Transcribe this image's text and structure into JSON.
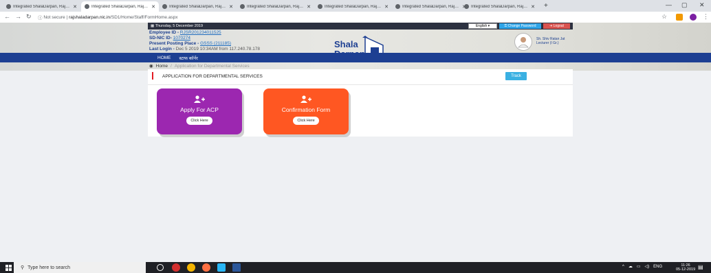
{
  "browser": {
    "tabs": [
      {
        "title": "Integrated ShalaDarpan, Rajasth",
        "active": false
      },
      {
        "title": "Integrated ShalaDarpan, Rajasth",
        "active": true
      },
      {
        "title": "Integrated ShalaDarpan, Rajasth",
        "active": false
      },
      {
        "title": "Integrated ShalaDarpan, Rajasth",
        "active": false
      },
      {
        "title": "Integrated ShalaDarpan, Rajasth",
        "active": false
      },
      {
        "title": "Integrated ShalaDarpan, Rajasth",
        "active": false
      },
      {
        "title": "Integrated ShalaDarpan, Rajasth",
        "active": false
      }
    ],
    "security_label": "Not secure",
    "url_host": "rajshaladarpan.nic.in",
    "url_path": "/SD1/Home/Staff/FormHome.aspx"
  },
  "header": {
    "date": "Thursday, 5 December 2019",
    "language": "English",
    "change_password": "Change Password",
    "logout": "Logout",
    "employee_id_label": "Employee ID -",
    "employee_id": "RJSR201234011525",
    "sdnic_label": "SD-NIC ID-",
    "sdnic_id": "1070274",
    "posting_label": "Present Posting Place -",
    "posting_place": "GSSS (211185)",
    "last_login_label": "Last Login -",
    "last_login": "Dec 5 2019 10:34AM from 117.240.78.178",
    "logo_line1": "Shala",
    "logo_line2": "Darpan",
    "profile_name": "Sh. Shiv Ratan Jat",
    "profile_role": "Lecturer (I Gr.)"
  },
  "nav": {
    "home": "HOME",
    "staff_corner": "स्टाफ कॉर्नर"
  },
  "breadcrumb": {
    "home": "Home",
    "current": "Application for Departmental Services"
  },
  "panel": {
    "title": "APPLICATION FOR DEPARTMENTAL SERVICES",
    "track": "Track",
    "cards": [
      {
        "title": "Apply For ACP",
        "button": "Click Here"
      },
      {
        "title": "Confirmation Form",
        "button": "Click Here"
      }
    ]
  },
  "taskbar": {
    "search_placeholder": "Type here to search",
    "lang": "ENG",
    "time": "11:26",
    "date": "05-12-2019"
  },
  "colors": {
    "nav_blue": "#1d3f92",
    "card_purple": "#9c27b0",
    "card_orange": "#ff5722",
    "track": "#3ab0e2",
    "logout": "#d9534f"
  }
}
